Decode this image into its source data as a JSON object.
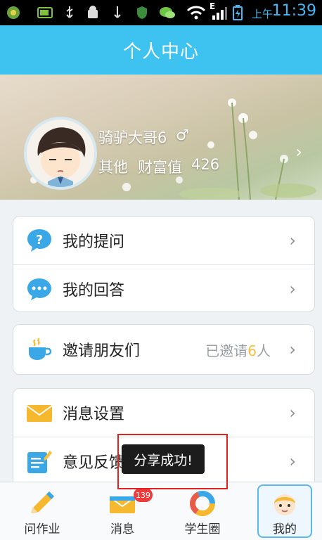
{
  "status_bar": {
    "ampm": "上午",
    "time": "11:39",
    "signal_letter": "E"
  },
  "header": {
    "title": "个人中心"
  },
  "profile": {
    "name": "骑驴大哥6",
    "gender_symbol": "♂",
    "role": "其他",
    "wealth_label": "财富值",
    "wealth_value": "426",
    "arrow": "›"
  },
  "menu": {
    "group1": [
      {
        "label": "我的提问",
        "icon": "question-bubble-icon",
        "chevron": "›"
      },
      {
        "label": "我的回答",
        "icon": "chat-bubble-icon",
        "chevron": "›"
      }
    ],
    "group2": [
      {
        "label": "邀请朋友们",
        "icon": "cup-icon",
        "right_prefix": "已邀请",
        "right_count": "6",
        "right_suffix": "人",
        "chevron": "›"
      }
    ],
    "group3": [
      {
        "label": "消息设置",
        "icon": "envelope-icon",
        "chevron": "›"
      },
      {
        "label": "意见反馈",
        "icon": "feedback-edit-icon",
        "chevron": "›"
      }
    ]
  },
  "toast": {
    "text": "分享成功!"
  },
  "bottom_nav": {
    "items": [
      {
        "label": "问作业",
        "icon": "pencil-icon"
      },
      {
        "label": "消息",
        "icon": "envelope-icon",
        "badge": "139"
      },
      {
        "label": "学生圈",
        "icon": "circle-ring-icon"
      },
      {
        "label": "我的",
        "icon": "avatar-face-icon",
        "active": true
      }
    ]
  },
  "colors": {
    "header_bg": "#3ec2ef",
    "accent_yellow": "#f5c03b",
    "badge_red": "#ee3b3b",
    "annotation_red": "#e0231f"
  }
}
